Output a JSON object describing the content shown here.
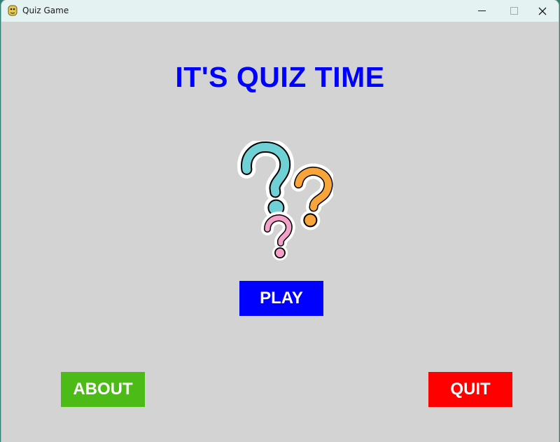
{
  "window": {
    "title": "Quiz Game",
    "app_icon": "python-snake-icon",
    "controls": {
      "minimize": "minimize-icon",
      "maximize": "maximize-icon",
      "close": "close-icon"
    }
  },
  "main": {
    "heading": "IT'S QUIZ TIME",
    "illustration": "question-marks-icon",
    "play_label": "PLAY",
    "about_label": "ABOUT",
    "quit_label": "QUIT"
  },
  "colors": {
    "background": "#d3d3d3",
    "heading": "#0000ff",
    "play": "#0000ff",
    "about": "#4cbb17",
    "quit": "#ff0000",
    "qmark_teal": "#6fd0d6",
    "qmark_orange": "#f7a43a",
    "qmark_pink": "#f3a1c8"
  }
}
